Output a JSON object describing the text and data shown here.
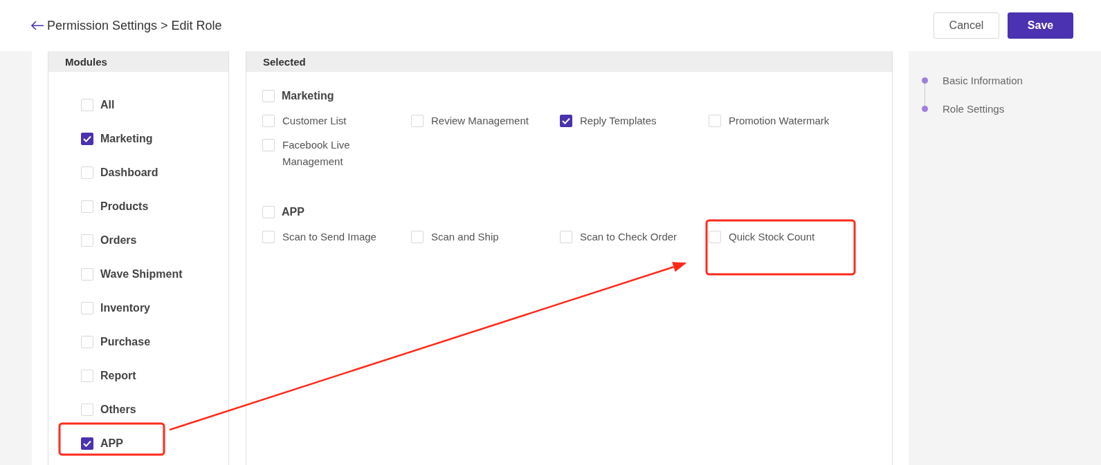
{
  "header": {
    "title": "Permission Settings > Edit Role",
    "buttons": [
      {
        "label": "Cancel",
        "kind": "secondary"
      },
      {
        "label": "Save",
        "kind": "primary"
      }
    ]
  },
  "modules": {
    "title": "Modules",
    "items": [
      {
        "label": "All",
        "checked": false
      },
      {
        "label": "Marketing",
        "checked": true
      },
      {
        "label": "Dashboard",
        "checked": false
      },
      {
        "label": "Products",
        "checked": false
      },
      {
        "label": "Orders",
        "checked": false
      },
      {
        "label": "Wave Shipment",
        "checked": false
      },
      {
        "label": "Inventory",
        "checked": false
      },
      {
        "label": "Purchase",
        "checked": false
      },
      {
        "label": "Report",
        "checked": false
      },
      {
        "label": "Others",
        "checked": false
      },
      {
        "label": "APP",
        "checked": true
      }
    ]
  },
  "selected": {
    "title": "Selected",
    "groups": [
      {
        "label": "Marketing",
        "checked": false,
        "items": [
          {
            "label": "Customer List",
            "checked": false
          },
          {
            "label": "Review Management",
            "checked": false
          },
          {
            "label": "Reply Templates",
            "checked": true
          },
          {
            "label": "Promotion Watermark",
            "checked": false
          },
          {
            "label": "Facebook Live Management",
            "checked": false
          }
        ]
      },
      {
        "label": "APP",
        "checked": false,
        "items": [
          {
            "label": "Scan to Send Image",
            "checked": false
          },
          {
            "label": "Scan and Ship",
            "checked": false
          },
          {
            "label": "Scan to Check Order",
            "checked": false
          },
          {
            "label": "Quick Stock Count",
            "checked": false
          }
        ]
      }
    ]
  },
  "steps": [
    {
      "label": "Basic Information"
    },
    {
      "label": "Role Settings"
    }
  ]
}
